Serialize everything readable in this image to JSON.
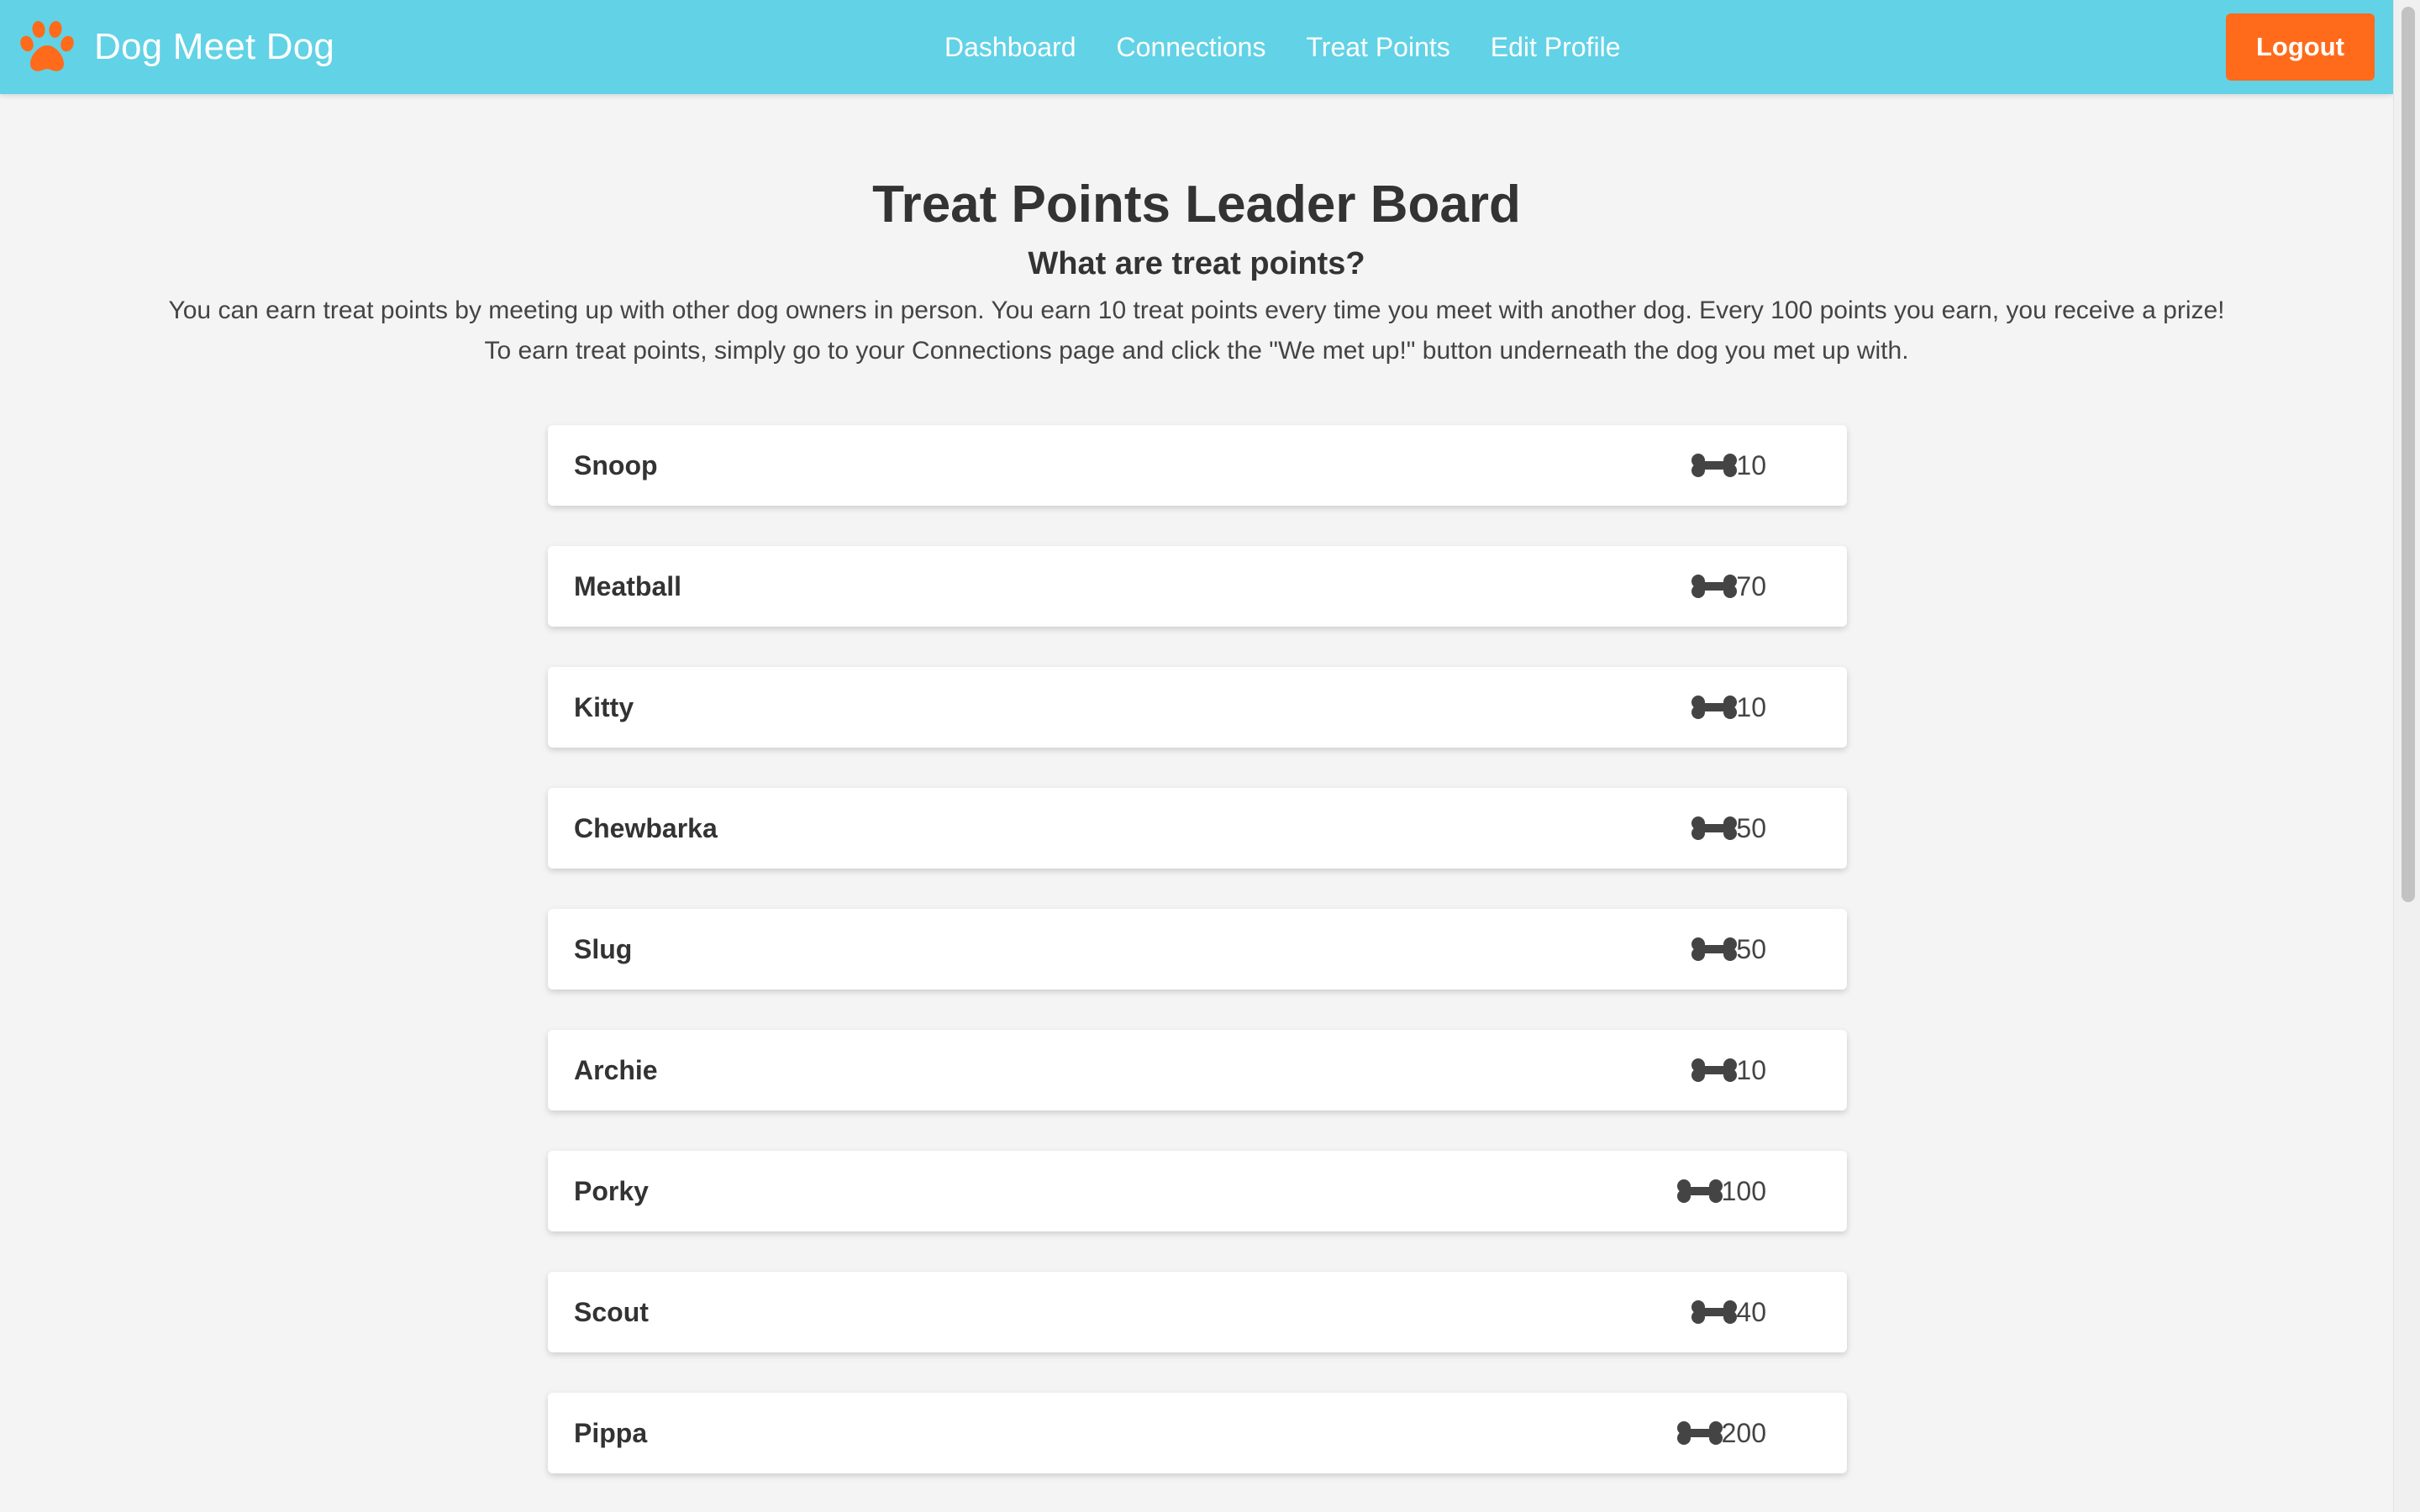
{
  "app": {
    "brand_name": "Dog Meet Dog",
    "brand_icon": "paw-icon"
  },
  "nav": {
    "links": [
      {
        "label": "Dashboard"
      },
      {
        "label": "Connections"
      },
      {
        "label": "Treat Points"
      },
      {
        "label": "Edit Profile"
      }
    ],
    "logout_label": "Logout"
  },
  "header": {
    "title": "Treat Points Leader Board",
    "subtitle": "What are treat points?",
    "description_line1": "You can earn treat points by meeting up with other dog owners in person. You earn 10 treat points every time you meet with another dog. Every 100 points you earn, you receive a prize!",
    "description_line2": "To earn treat points, simply go to your Connections page and click the \"We met up!\" button underneath the dog you met up with."
  },
  "leaderboard": {
    "icon": "bone-icon",
    "entries": [
      {
        "name": "Snoop",
        "points": "10"
      },
      {
        "name": "Meatball",
        "points": "70"
      },
      {
        "name": "Kitty",
        "points": "10"
      },
      {
        "name": "Chewbarka",
        "points": "50"
      },
      {
        "name": "Slug",
        "points": "50"
      },
      {
        "name": "Archie",
        "points": "10"
      },
      {
        "name": "Porky",
        "points": "100"
      },
      {
        "name": "Scout",
        "points": "40"
      },
      {
        "name": "Pippa",
        "points": "200"
      }
    ]
  },
  "colors": {
    "navbar": "#62d2e6",
    "accent": "#ff6b1a",
    "background": "#f4f4f4",
    "card": "#ffffff",
    "text": "#333333"
  }
}
